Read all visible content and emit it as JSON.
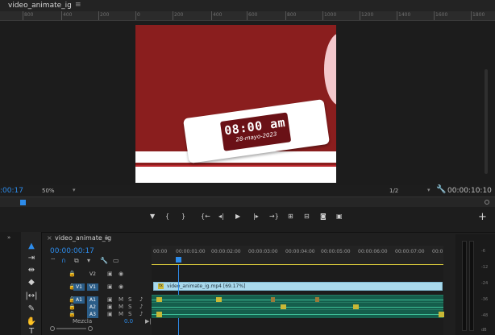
{
  "program_monitor": {
    "title": "video_animate_ig",
    "menu_icon": "≡",
    "ruler_labels": [
      "800",
      "400",
      "200",
      "0",
      "200",
      "400",
      "600",
      "800",
      "1000",
      "1200",
      "1400",
      "1600",
      "1800"
    ],
    "frame": {
      "time_text": "08:00 am",
      "date_text": "28-mayo-2023",
      "colors": {
        "background": "#8a1e1e",
        "card": "#ffffff",
        "clock": "#6a1116",
        "swoosh": "#f3c8cc"
      }
    },
    "current_timecode": ":00:17",
    "zoom": "50%",
    "resolution": "1/2",
    "duration": "00:00:10:10"
  },
  "transport": {
    "buttons": [
      {
        "name": "add-marker-button",
        "icon": "▼"
      },
      {
        "name": "mark-in-button",
        "icon": "{"
      },
      {
        "name": "mark-out-button",
        "icon": "}"
      },
      {
        "name": "go-to-in-button",
        "icon": "{←"
      },
      {
        "name": "step-back-button",
        "icon": "◂|"
      },
      {
        "name": "play-button",
        "icon": "▶"
      },
      {
        "name": "step-forward-button",
        "icon": "|▸"
      },
      {
        "name": "go-to-out-button",
        "icon": "→}"
      },
      {
        "name": "lift-button",
        "icon": "⊞"
      },
      {
        "name": "extract-button",
        "icon": "⊟"
      },
      {
        "name": "export-frame-button",
        "icon": "◙"
      },
      {
        "name": "comparison-view-button",
        "icon": "▣"
      }
    ],
    "add_button": "+"
  },
  "tools": {
    "panel_chevron": "»",
    "items": [
      {
        "name": "selection-tool",
        "icon": "▲",
        "selected": true
      },
      {
        "name": "track-select-tool",
        "icon": "⇥",
        "selected": false
      },
      {
        "name": "ripple-edit-tool",
        "icon": "⇹",
        "selected": false
      },
      {
        "name": "razor-tool",
        "icon": "◆",
        "selected": false
      },
      {
        "name": "slip-tool",
        "icon": "|↔|",
        "selected": false
      },
      {
        "name": "pen-tool",
        "icon": "✎",
        "selected": false
      },
      {
        "name": "hand-tool",
        "icon": "✋",
        "selected": false
      },
      {
        "name": "type-tool",
        "icon": "T",
        "selected": false
      }
    ]
  },
  "timeline": {
    "close": "×",
    "sequence_name": "video_animate_ig",
    "menu_icon": "≡",
    "timecode": "00:00:00:17",
    "ruler_labels": [
      "00:00",
      "00:00:01:00",
      "00:00:02:00",
      "00:00:03:00",
      "00:00:04:00",
      "00:00:05:00",
      "00:00:06:00",
      "00:00:07:00",
      "00:0"
    ],
    "tracks": [
      {
        "id": "V2",
        "type": "video",
        "source_on": false,
        "target_on": false,
        "lock": "🔒"
      },
      {
        "id": "V1",
        "type": "video",
        "source_label": "V1",
        "source_on": true,
        "target_on": true,
        "lock": "🔒"
      },
      {
        "id": "A1",
        "type": "audio",
        "source_label": "A1",
        "source_on": true,
        "target_on": true,
        "m": "M",
        "s": "S",
        "lock": "🔒"
      },
      {
        "id": "A2",
        "type": "audio",
        "source_on": false,
        "target_on": true,
        "m": "M",
        "s": "S",
        "lock": "🔒"
      },
      {
        "id": "A3",
        "type": "audio",
        "source_on": false,
        "target_on": true,
        "m": "M",
        "s": "S",
        "lock": "🔒"
      }
    ],
    "mix_label": "Mezcla",
    "mix_value": "0.0",
    "clip_label": "video_animate_ig.mp4 [69.17%]"
  },
  "meters": {
    "scale": [
      "-6",
      "-12",
      "-24",
      "-36",
      "-48",
      "dB"
    ]
  }
}
